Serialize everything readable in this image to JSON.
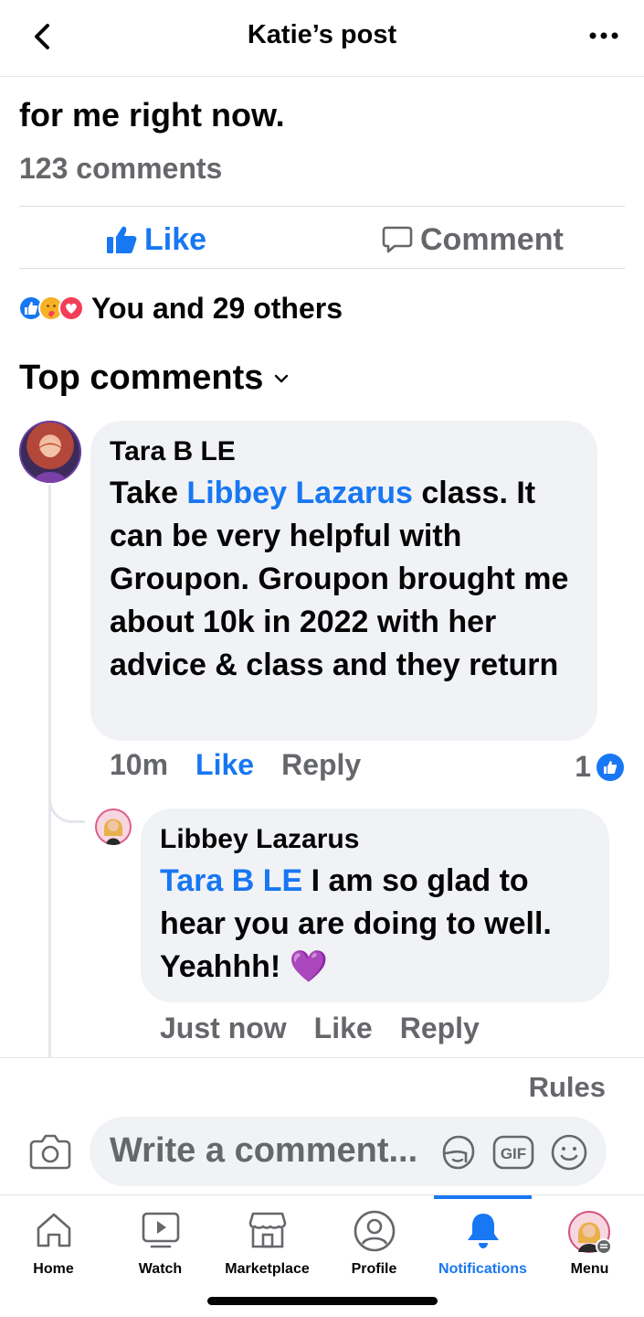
{
  "header": {
    "title": "Katie’s post"
  },
  "post": {
    "text_tail": "for me right now.",
    "comments_count": "123 comments",
    "like_label": "Like",
    "comment_label": "Comment",
    "reactions_text": "You and 29 others"
  },
  "section": {
    "title": "Top comments"
  },
  "comments": [
    {
      "author": "Tara B LE",
      "text_before": "Take ",
      "mention": "Libbey Lazarus",
      "text_after": " class. It can be very helpful with Groupon. Groupon brought me about 10k in 2022 with her advice & class and they return",
      "time": "10m",
      "like": "Like",
      "reply": "Reply",
      "like_count": "1"
    },
    {
      "author": "Libbey Lazarus",
      "mention": "Tara B LE",
      "text_after": " I am so glad to hear you are doing to well. Yeahhh! 💜",
      "time": "Just now",
      "like": "Like",
      "reply": "Reply"
    }
  ],
  "composer": {
    "rules": "Rules",
    "placeholder": "Write a comment..."
  },
  "tabs": [
    {
      "label": "Home",
      "icon": "home-icon"
    },
    {
      "label": "Watch",
      "icon": "watch-icon"
    },
    {
      "label": "Marketplace",
      "icon": "marketplace-icon"
    },
    {
      "label": "Profile",
      "icon": "profile-icon"
    },
    {
      "label": "Notifications",
      "icon": "bell-icon",
      "active": true
    },
    {
      "label": "Menu",
      "icon": "avatar"
    }
  ],
  "colors": {
    "accent": "#1877f2",
    "secondary_text": "#65676b",
    "bubble": "#f0f2f5"
  }
}
